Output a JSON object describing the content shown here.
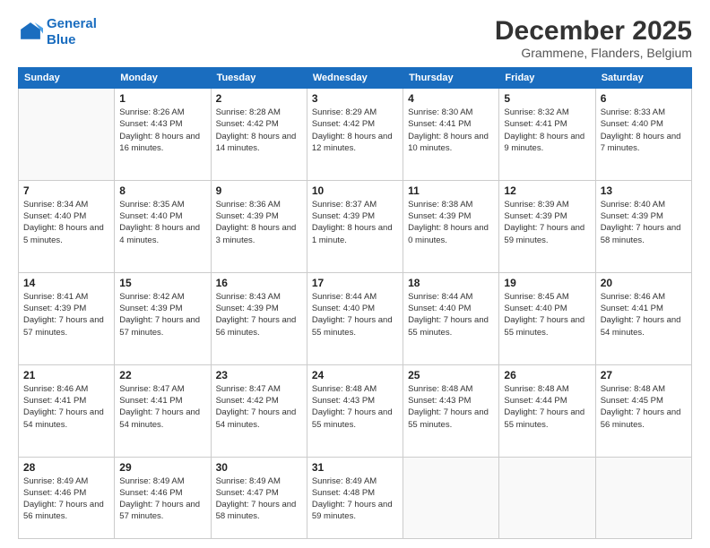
{
  "header": {
    "logo_line1": "General",
    "logo_line2": "Blue",
    "month": "December 2025",
    "location": "Grammene, Flanders, Belgium"
  },
  "weekdays": [
    "Sunday",
    "Monday",
    "Tuesday",
    "Wednesday",
    "Thursday",
    "Friday",
    "Saturday"
  ],
  "weeks": [
    [
      {
        "day": "",
        "sunrise": "",
        "sunset": "",
        "daylight": ""
      },
      {
        "day": "1",
        "sunrise": "Sunrise: 8:26 AM",
        "sunset": "Sunset: 4:43 PM",
        "daylight": "Daylight: 8 hours and 16 minutes."
      },
      {
        "day": "2",
        "sunrise": "Sunrise: 8:28 AM",
        "sunset": "Sunset: 4:42 PM",
        "daylight": "Daylight: 8 hours and 14 minutes."
      },
      {
        "day": "3",
        "sunrise": "Sunrise: 8:29 AM",
        "sunset": "Sunset: 4:42 PM",
        "daylight": "Daylight: 8 hours and 12 minutes."
      },
      {
        "day": "4",
        "sunrise": "Sunrise: 8:30 AM",
        "sunset": "Sunset: 4:41 PM",
        "daylight": "Daylight: 8 hours and 10 minutes."
      },
      {
        "day": "5",
        "sunrise": "Sunrise: 8:32 AM",
        "sunset": "Sunset: 4:41 PM",
        "daylight": "Daylight: 8 hours and 9 minutes."
      },
      {
        "day": "6",
        "sunrise": "Sunrise: 8:33 AM",
        "sunset": "Sunset: 4:40 PM",
        "daylight": "Daylight: 8 hours and 7 minutes."
      }
    ],
    [
      {
        "day": "7",
        "sunrise": "Sunrise: 8:34 AM",
        "sunset": "Sunset: 4:40 PM",
        "daylight": "Daylight: 8 hours and 5 minutes."
      },
      {
        "day": "8",
        "sunrise": "Sunrise: 8:35 AM",
        "sunset": "Sunset: 4:40 PM",
        "daylight": "Daylight: 8 hours and 4 minutes."
      },
      {
        "day": "9",
        "sunrise": "Sunrise: 8:36 AM",
        "sunset": "Sunset: 4:39 PM",
        "daylight": "Daylight: 8 hours and 3 minutes."
      },
      {
        "day": "10",
        "sunrise": "Sunrise: 8:37 AM",
        "sunset": "Sunset: 4:39 PM",
        "daylight": "Daylight: 8 hours and 1 minute."
      },
      {
        "day": "11",
        "sunrise": "Sunrise: 8:38 AM",
        "sunset": "Sunset: 4:39 PM",
        "daylight": "Daylight: 8 hours and 0 minutes."
      },
      {
        "day": "12",
        "sunrise": "Sunrise: 8:39 AM",
        "sunset": "Sunset: 4:39 PM",
        "daylight": "Daylight: 7 hours and 59 minutes."
      },
      {
        "day": "13",
        "sunrise": "Sunrise: 8:40 AM",
        "sunset": "Sunset: 4:39 PM",
        "daylight": "Daylight: 7 hours and 58 minutes."
      }
    ],
    [
      {
        "day": "14",
        "sunrise": "Sunrise: 8:41 AM",
        "sunset": "Sunset: 4:39 PM",
        "daylight": "Daylight: 7 hours and 57 minutes."
      },
      {
        "day": "15",
        "sunrise": "Sunrise: 8:42 AM",
        "sunset": "Sunset: 4:39 PM",
        "daylight": "Daylight: 7 hours and 57 minutes."
      },
      {
        "day": "16",
        "sunrise": "Sunrise: 8:43 AM",
        "sunset": "Sunset: 4:39 PM",
        "daylight": "Daylight: 7 hours and 56 minutes."
      },
      {
        "day": "17",
        "sunrise": "Sunrise: 8:44 AM",
        "sunset": "Sunset: 4:40 PM",
        "daylight": "Daylight: 7 hours and 55 minutes."
      },
      {
        "day": "18",
        "sunrise": "Sunrise: 8:44 AM",
        "sunset": "Sunset: 4:40 PM",
        "daylight": "Daylight: 7 hours and 55 minutes."
      },
      {
        "day": "19",
        "sunrise": "Sunrise: 8:45 AM",
        "sunset": "Sunset: 4:40 PM",
        "daylight": "Daylight: 7 hours and 55 minutes."
      },
      {
        "day": "20",
        "sunrise": "Sunrise: 8:46 AM",
        "sunset": "Sunset: 4:41 PM",
        "daylight": "Daylight: 7 hours and 54 minutes."
      }
    ],
    [
      {
        "day": "21",
        "sunrise": "Sunrise: 8:46 AM",
        "sunset": "Sunset: 4:41 PM",
        "daylight": "Daylight: 7 hours and 54 minutes."
      },
      {
        "day": "22",
        "sunrise": "Sunrise: 8:47 AM",
        "sunset": "Sunset: 4:41 PM",
        "daylight": "Daylight: 7 hours and 54 minutes."
      },
      {
        "day": "23",
        "sunrise": "Sunrise: 8:47 AM",
        "sunset": "Sunset: 4:42 PM",
        "daylight": "Daylight: 7 hours and 54 minutes."
      },
      {
        "day": "24",
        "sunrise": "Sunrise: 8:48 AM",
        "sunset": "Sunset: 4:43 PM",
        "daylight": "Daylight: 7 hours and 55 minutes."
      },
      {
        "day": "25",
        "sunrise": "Sunrise: 8:48 AM",
        "sunset": "Sunset: 4:43 PM",
        "daylight": "Daylight: 7 hours and 55 minutes."
      },
      {
        "day": "26",
        "sunrise": "Sunrise: 8:48 AM",
        "sunset": "Sunset: 4:44 PM",
        "daylight": "Daylight: 7 hours and 55 minutes."
      },
      {
        "day": "27",
        "sunrise": "Sunrise: 8:48 AM",
        "sunset": "Sunset: 4:45 PM",
        "daylight": "Daylight: 7 hours and 56 minutes."
      }
    ],
    [
      {
        "day": "28",
        "sunrise": "Sunrise: 8:49 AM",
        "sunset": "Sunset: 4:46 PM",
        "daylight": "Daylight: 7 hours and 56 minutes."
      },
      {
        "day": "29",
        "sunrise": "Sunrise: 8:49 AM",
        "sunset": "Sunset: 4:46 PM",
        "daylight": "Daylight: 7 hours and 57 minutes."
      },
      {
        "day": "30",
        "sunrise": "Sunrise: 8:49 AM",
        "sunset": "Sunset: 4:47 PM",
        "daylight": "Daylight: 7 hours and 58 minutes."
      },
      {
        "day": "31",
        "sunrise": "Sunrise: 8:49 AM",
        "sunset": "Sunset: 4:48 PM",
        "daylight": "Daylight: 7 hours and 59 minutes."
      },
      {
        "day": "",
        "sunrise": "",
        "sunset": "",
        "daylight": ""
      },
      {
        "day": "",
        "sunrise": "",
        "sunset": "",
        "daylight": ""
      },
      {
        "day": "",
        "sunrise": "",
        "sunset": "",
        "daylight": ""
      }
    ]
  ]
}
